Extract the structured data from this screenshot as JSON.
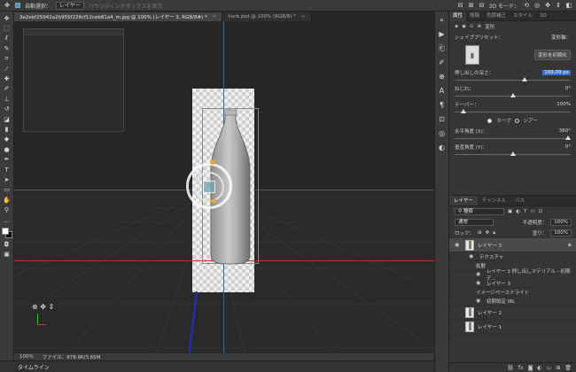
{
  "options_bar": {
    "auto_select_label": "自動選択：",
    "auto_select_target": "レイヤー",
    "transform_controls_label": "バウンディングボックスを表示",
    "mode_label": "3D モード："
  },
  "tabs": [
    {
      "label": "3e2ebf25942a2b955f226cf12ceb81a4_m.jpg @ 100% (レイヤー 3, RGB/8#) *",
      "active": true
    },
    {
      "label": "horb.psd @ 100% (RGB/8) *",
      "active": false
    }
  ],
  "status": {
    "zoom": "100%",
    "file_info": "ファイル：878.9K/3.65M"
  },
  "timeline_label": "タイムライン",
  "properties": {
    "tabs": [
      "属性",
      "情報",
      "色調補正",
      "スタイル",
      "3D"
    ],
    "mode_label": "変形",
    "shape_preset_label": "シェイププリセット：",
    "deform_axis_label": "変形軸：",
    "reset_button": "変形を初期化",
    "extrusion_depth_label": "押し出しの深さ：",
    "extrusion_depth_value": "169.09 px",
    "twist_label": "ねじれ：",
    "twist_value": "0°",
    "taper_label": "テーパー：",
    "taper_value": "100%",
    "curve_label": "カーブ",
    "shear_label": "シアー",
    "horizontal_angle_label": "水平角度 (X)：",
    "horizontal_angle_value": "360°",
    "vertical_angle_label": "垂直角度 (Y)：",
    "vertical_angle_value": "0°"
  },
  "layers_panel": {
    "tabs": [
      "レイヤー",
      "チャンネル",
      "パス"
    ],
    "search_kind": "種類",
    "blend_mode": "通常",
    "opacity_label": "不透明度：",
    "opacity_value": "100%",
    "lock_label": "ロック：",
    "fill_label": "塗り：",
    "fill_value": "100%",
    "layers": [
      {
        "name": "レイヤー 3",
        "type": "3d"
      },
      {
        "name": "テクスチャ",
        "type": "sub"
      },
      {
        "name": "拡散",
        "type": "sub2"
      },
      {
        "name": "レイヤー 3 押し出しマテリアル - 初期デ...",
        "type": "sub3"
      },
      {
        "name": "レイヤー 3",
        "type": "sub3"
      },
      {
        "name": "イメージベースドライト",
        "type": "sub2"
      },
      {
        "name": "初期設定 IBL",
        "type": "sub3"
      },
      {
        "name": "レイヤー 2",
        "type": "normal"
      },
      {
        "name": "レイヤー 1",
        "type": "normal"
      }
    ]
  },
  "colors": {
    "accent": "#3b6ecd",
    "ground_line": "#c42a2a",
    "axis_blue": "#1e2ec8"
  }
}
